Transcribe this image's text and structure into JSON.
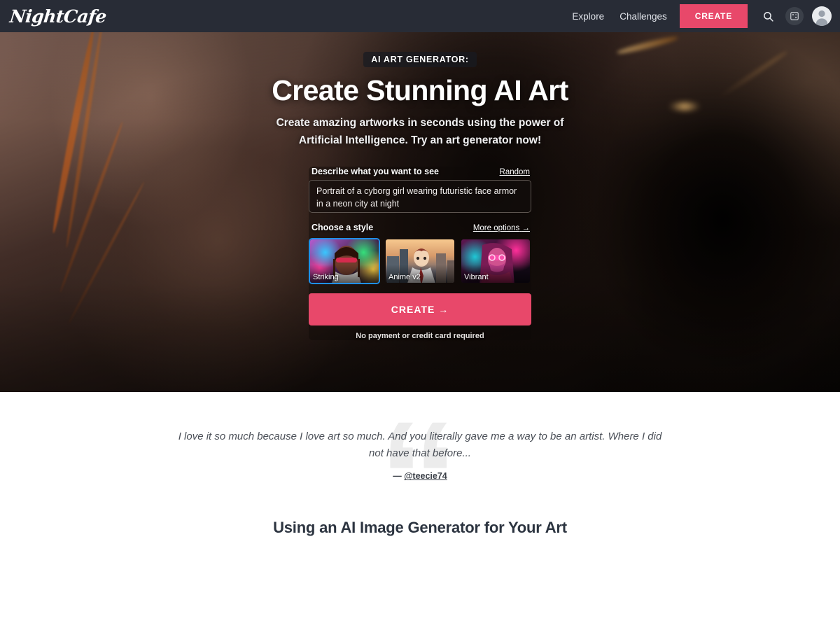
{
  "navbar": {
    "logo": "NightCafe",
    "links": [
      {
        "label": "Explore",
        "name": "nav-link-explore"
      },
      {
        "label": "Challenges",
        "name": "nav-link-challenges"
      }
    ],
    "create_label": "CREATE",
    "icons": {
      "search": "search-icon",
      "dice": "dice-icon",
      "avatar": "user-avatar-icon"
    },
    "colors": {
      "background": "#282c36",
      "accent": "#e8486a"
    }
  },
  "hero": {
    "eyebrow": "AI ART GENERATOR:",
    "title": "Create Stunning AI Art",
    "subtitle": "Create amazing artworks in seconds using the power of Artificial Intelligence. Try an art generator now!",
    "form": {
      "prompt_label": "Describe what you want to see",
      "random_label": "Random",
      "prompt_value": "Portrait of a cyborg girl wearing futuristic face armor in a neon city at night",
      "prompt_placeholder": "Describe what you want to see",
      "style_label": "Choose a style",
      "more_options_label": "More options",
      "more_options_arrow": "→",
      "styles": [
        {
          "name": "Striking",
          "selected": true
        },
        {
          "name": "Anime v2",
          "selected": false
        },
        {
          "name": "Vibrant",
          "selected": false
        }
      ],
      "create_label": "CREATE",
      "create_arrow": "→",
      "create_note": "No payment or credit card required"
    }
  },
  "testimonial": {
    "quote_glyph": "“",
    "text": "I love it so much because I love art so much. And you literally gave me a way to be an artist. Where I did not have that before...",
    "dash": "—",
    "author": "@teecie74"
  },
  "section": {
    "heading": "Using an AI Image Generator for Your Art"
  }
}
